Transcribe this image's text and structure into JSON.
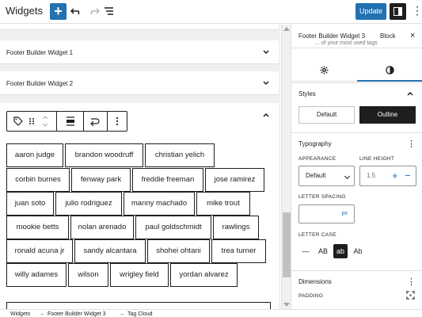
{
  "topbar": {
    "title": "Widgets",
    "add_label": "+",
    "update_label": "Update",
    "more_label": "⋮"
  },
  "canvas": {
    "panels": [
      {
        "title": "Footer Builder Widget 1"
      },
      {
        "title": "Footer Builder Widget 2"
      }
    ],
    "tags": [
      "aaron judge",
      "brandon woodruff",
      "christian yelich",
      "corbin burnes",
      "fenway park",
      "freddie freeman",
      "jose ramirez",
      "juan soto",
      "julio rodriguez",
      "manny machado",
      "mike trout",
      "mookie betts",
      "nolan arenado",
      "paul goldschmidt",
      "rawlings",
      "ronald acuna jr",
      "sandy alcantara",
      "shohei ohtani",
      "trea turner",
      "willy adames",
      "wilson",
      "wrigley field",
      "yordan alvarez"
    ]
  },
  "footer": {
    "crumbs": [
      "Widgets",
      "→",
      "Footer Builder Widget 3",
      "→",
      "Tag Cloud"
    ]
  },
  "sidebar": {
    "tab_widget": "Footer Builder Widget 3",
    "tab_block": "Block",
    "close_label": "×",
    "cut_text": "... of your most used tags",
    "styles": {
      "title": "Styles",
      "options": [
        "Default",
        "Outline"
      ],
      "selected": "Outline"
    },
    "typography": {
      "title": "Typography",
      "appearance_label": "APPEARANCE",
      "appearance_value": "Default",
      "line_height_label": "LINE HEIGHT",
      "line_height_value": "1.5",
      "letter_spacing_label": "LETTER SPACING",
      "letter_spacing_unit": "px",
      "letter_case_label": "LETTER CASE",
      "case_options": [
        "—",
        "AB",
        "ab",
        "Ab"
      ],
      "case_selected": "ab"
    },
    "dimensions": {
      "title": "Dimensions",
      "padding_label": "PADDING"
    }
  },
  "colors": {
    "accent": "#2271b1",
    "dark": "#1e1e1e",
    "border": "#e0e0e0"
  }
}
